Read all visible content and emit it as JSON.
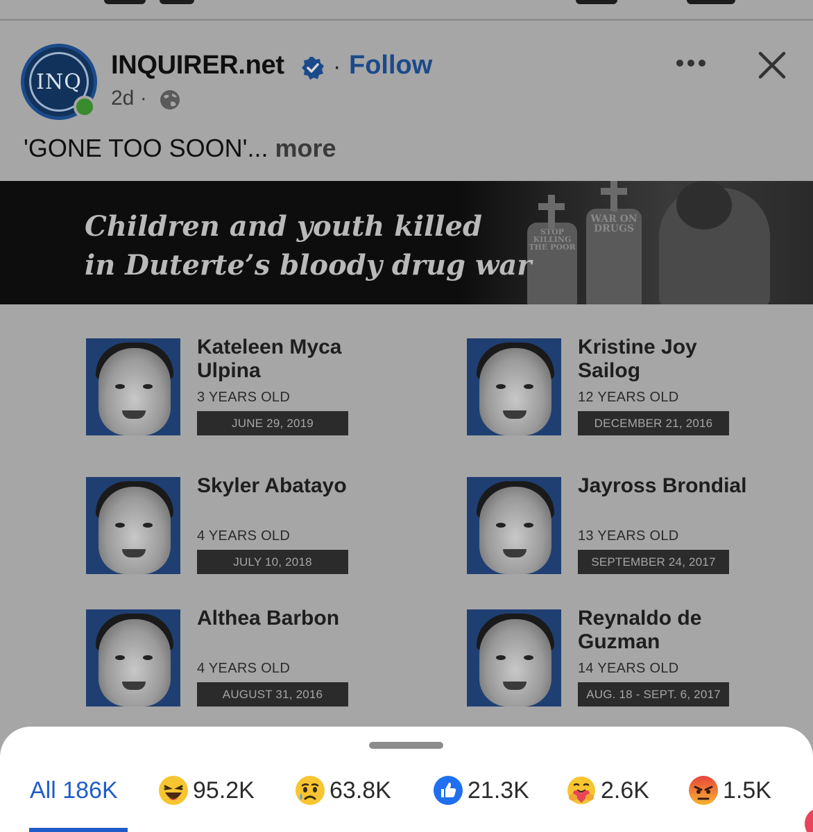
{
  "post": {
    "page_name": "INQUIRER.net",
    "avatar_text": "INQ",
    "separator": "·",
    "follow_label": "Follow",
    "age": "2d ·",
    "caption": "'GONE TOO SOON'...",
    "caption_more": "more"
  },
  "banner": {
    "title_line1": "Children and youth killed",
    "title_line2": "in Duterte’s bloody drug war",
    "sign_left": "STOP KILLING THE POOR",
    "sign_right": "WAR ON DRUGS"
  },
  "victims": [
    {
      "name": "Kateleen Myca Ulpina",
      "age": "3 YEARS OLD",
      "date": "JUNE 29, 2019"
    },
    {
      "name": "Kristine Joy Sailog",
      "age": "12 YEARS OLD",
      "date": "DECEMBER 21, 2016"
    },
    {
      "name": "Skyler Abatayo",
      "age": "4 YEARS OLD",
      "date": "JULY 10, 2018"
    },
    {
      "name": "Jayross Brondial",
      "age": "13 YEARS OLD",
      "date": "SEPTEMBER 24, 2017"
    },
    {
      "name": "Althea Barbon",
      "age": "4 YEARS OLD",
      "date": "AUGUST 31, 2016"
    },
    {
      "name": "Reynaldo de Guzman",
      "age": "14 YEARS OLD",
      "date": "AUG. 18 - SEPT. 6, 2017"
    }
  ],
  "reactions": {
    "all": "All 186K",
    "items": [
      {
        "icon": "haha-icon",
        "count": "95.2K"
      },
      {
        "icon": "sad-icon",
        "count": "63.8K"
      },
      {
        "icon": "like-icon",
        "count": "21.3K"
      },
      {
        "icon": "care-icon",
        "count": "2.6K"
      },
      {
        "icon": "angry-icon",
        "count": "1.5K"
      }
    ]
  },
  "colors": {
    "accent": "#1f5cc9",
    "follow": "#1b4a8a",
    "online": "#3a8a2e",
    "photo_bg": "#1f3f72"
  }
}
